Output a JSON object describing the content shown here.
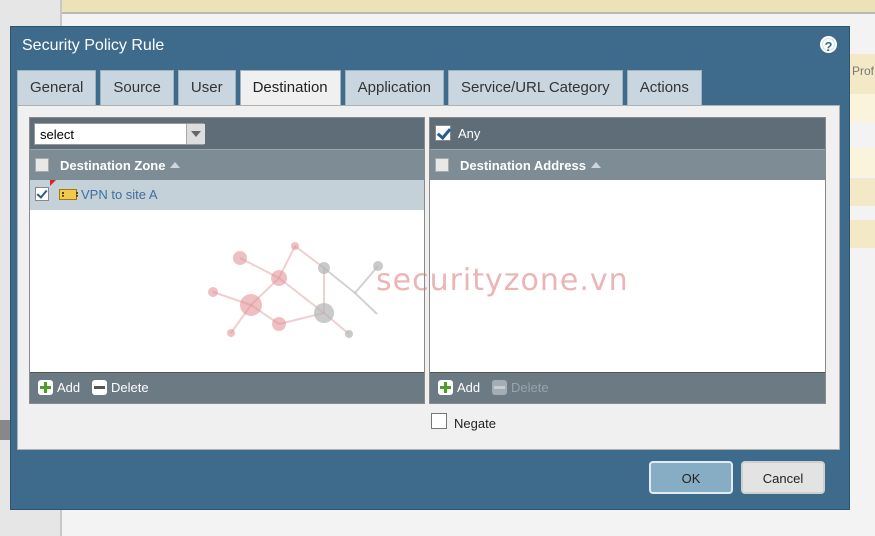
{
  "background": {
    "right_header_text": "Prof"
  },
  "dialog": {
    "title": "Security Policy Rule",
    "help_label": "?",
    "tabs": [
      {
        "label": "General"
      },
      {
        "label": "Source"
      },
      {
        "label": "User"
      },
      {
        "label": "Destination",
        "active": true
      },
      {
        "label": "Application"
      },
      {
        "label": "Service/URL Category"
      },
      {
        "label": "Actions"
      }
    ]
  },
  "left_panel": {
    "select_value": "select",
    "column_header": "Destination Zone",
    "rows": [
      {
        "label": "VPN to site A",
        "checked": true
      }
    ],
    "add_label": "Add",
    "delete_label": "Delete"
  },
  "right_panel": {
    "any_label": "Any",
    "any_checked": true,
    "column_header": "Destination Address",
    "rows": [],
    "add_label": "Add",
    "delete_label": "Delete"
  },
  "negate": {
    "label": "Negate",
    "checked": false
  },
  "buttons": {
    "ok": "OK",
    "cancel": "Cancel"
  },
  "watermark": {
    "text": "securityzone.vn"
  }
}
